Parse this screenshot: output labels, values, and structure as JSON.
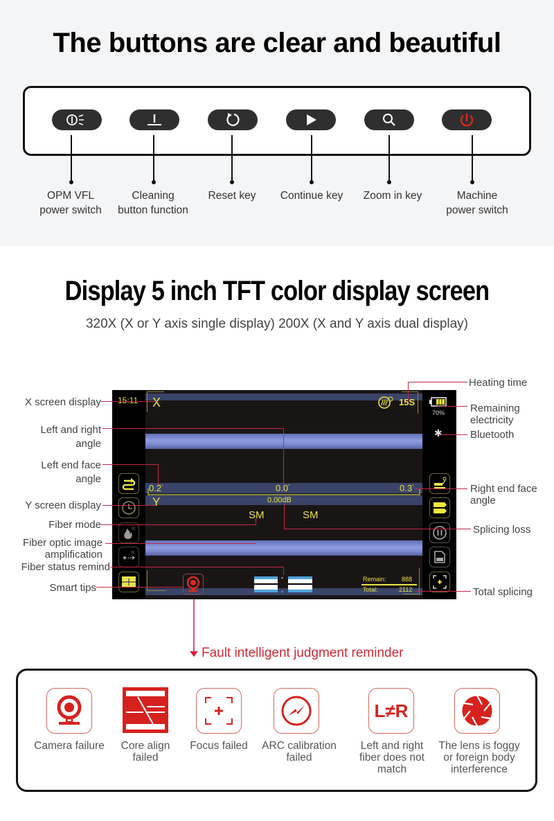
{
  "section_buttons": {
    "title": "The buttons are clear and beautiful",
    "keys": [
      {
        "icon": "opm-vfl-icon",
        "label_line1": "OPM VFL",
        "label_line2": "power switch"
      },
      {
        "icon": "cleaning-icon",
        "label_line1": "Cleaning",
        "label_line2": "button function"
      },
      {
        "icon": "reset-icon",
        "label_line1": "Reset key",
        "label_line2": ""
      },
      {
        "icon": "play-icon",
        "label_line1": "Continue key",
        "label_line2": ""
      },
      {
        "icon": "search-icon",
        "label_line1": "Zoom in key",
        "label_line2": ""
      },
      {
        "icon": "power-icon",
        "label_line1": "Machine",
        "label_line2": "power switch"
      }
    ]
  },
  "section_display": {
    "title": "Display 5 inch TFT color display screen",
    "subtitle": "320X (X or Y axis single display)  200X (X and Y axis dual display)",
    "screen": {
      "time": "15:11",
      "x_label": "X",
      "y_label": "Y",
      "heating_time": "15S",
      "battery_percent": "70%",
      "battery_level": 0.7,
      "left_angle": "0.2",
      "center_angle": "0.0",
      "right_angle": "0.3",
      "degree_mark": "°",
      "splice_loss": "0.00dB",
      "fiber_mode_left": "SM",
      "fiber_mode_right": "SM",
      "remain_label": "Remain:",
      "remain_value": "888",
      "total_label": "Total:",
      "total_value": "2112"
    },
    "callouts_left": {
      "x_screen": "X screen display",
      "lr_angle_1": "Left and right",
      "lr_angle_2": "angle",
      "left_end_1": "Left end face",
      "left_end_2": "angle",
      "y_screen": "Y screen display",
      "fiber_mode": "Fiber mode",
      "fiber_amp_1": "Fiber optic image",
      "fiber_amp_2": "amplification",
      "fiber_status": "Fiber status remind",
      "smart_tips": "Smart tips"
    },
    "callouts_right": {
      "heating": "Heating time",
      "remaining_1": "Remaining",
      "remaining_2": "electricity",
      "bluetooth": "Bluetooth",
      "right_end_1": "Right end face",
      "right_end_2": "angle",
      "splice_loss": "Splicing loss",
      "total_splicing": "Total splicing"
    }
  },
  "section_fault": {
    "title": "Fault intelligent judgment reminder",
    "accent_color": "#d6221f",
    "items": [
      {
        "icon": "camera-icon",
        "line1": "Camera failure",
        "line2": "",
        "line3": ""
      },
      {
        "icon": "core-align-icon",
        "line1": "Core align",
        "line2": "failed",
        "line3": ""
      },
      {
        "icon": "focus-icon",
        "line1": "Focus failed",
        "line2": "",
        "line3": ""
      },
      {
        "icon": "arc-icon",
        "line1": "ARC calibration",
        "line2": "failed",
        "line3": ""
      },
      {
        "icon": "l-not-equal-r-icon",
        "line1": "Left and right",
        "line2": "fiber does not",
        "line3": "match",
        "glyph": "L≠R"
      },
      {
        "icon": "lens-aperture-icon",
        "line1": "The lens is foggy",
        "line2": "or foreign body",
        "line3": "interference"
      }
    ]
  }
}
